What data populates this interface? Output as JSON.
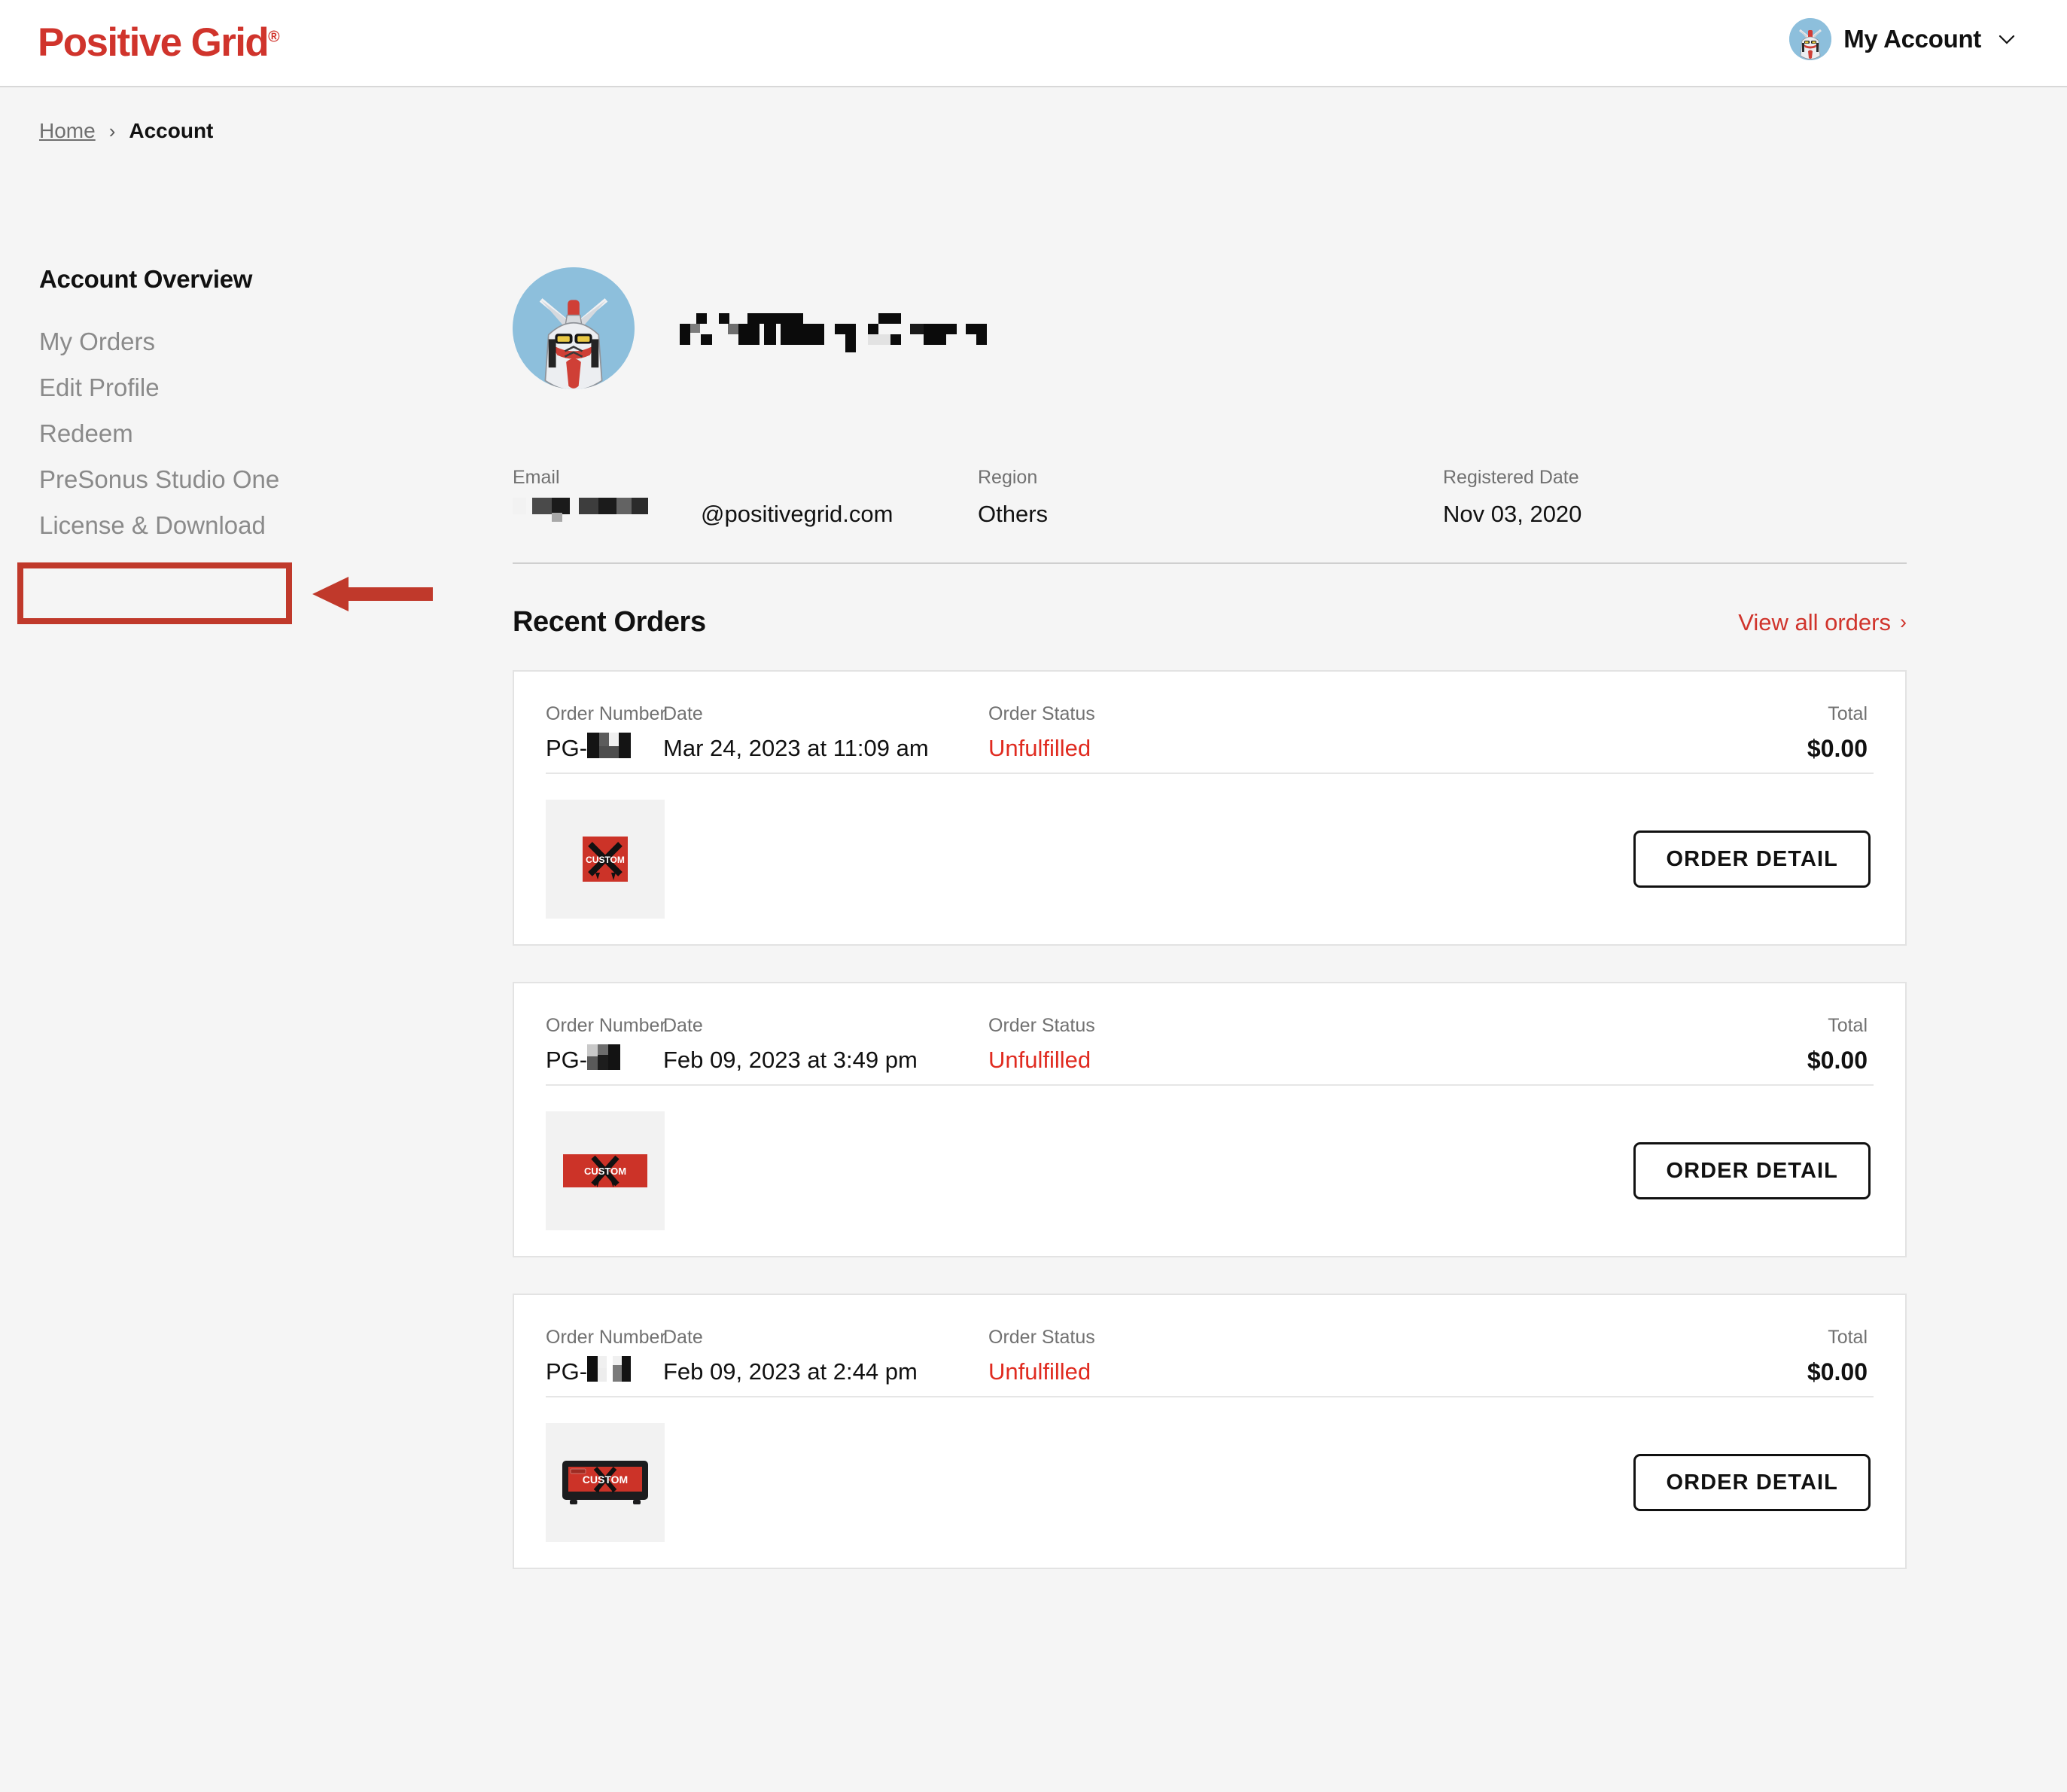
{
  "brand": {
    "name": "Positive Grid",
    "registered_mark": "®",
    "color": "#d0342c"
  },
  "header": {
    "account_label": "My Account",
    "avatar_alt": "gundam-avatar",
    "chevron": "chevron-down-icon"
  },
  "breadcrumb": {
    "home": "Home",
    "separator": "›",
    "current": "Account"
  },
  "sidebar": {
    "heading": "Account Overview",
    "items": [
      {
        "label": "My Orders",
        "active": false
      },
      {
        "label": "Edit Profile",
        "active": false
      },
      {
        "label": "Redeem",
        "active": false
      },
      {
        "label": "PreSonus Studio One",
        "active": false
      },
      {
        "label": "License & Download",
        "active": false,
        "annotated": true
      }
    ]
  },
  "annotation": {
    "color": "#c0392b",
    "target": "License & Download",
    "shape": "rectangle-with-left-arrow"
  },
  "profile": {
    "display_name": "[redacted]",
    "fields": [
      {
        "label": "Email",
        "value": "███ ████@positivegrid.com"
      },
      {
        "label": "Region",
        "value": "Others"
      },
      {
        "label": "Registered Date",
        "value": "Nov 03, 2020"
      }
    ]
  },
  "orders_section": {
    "title": "Recent Orders",
    "view_all_label": "View all orders",
    "view_all_chevron": "›",
    "column_labels": {
      "number": "Order Number",
      "date": "Date",
      "status": "Order Status",
      "total": "Total"
    },
    "detail_button_label": "ORDER DETAIL",
    "status_color": "#e02b20",
    "orders": [
      {
        "number_prefix": "PG-",
        "number_value": "[redacted]",
        "date": "Mar 24, 2023 at 11:09 am",
        "status": "Unfulfilled",
        "total": "$0.00",
        "thumbnail": "custom-square-badge"
      },
      {
        "number_prefix": "PG-",
        "number_value": "[redacted]",
        "date": "Feb 09, 2023 at 3:49 pm",
        "status": "Unfulfilled",
        "total": "$0.00",
        "thumbnail": "custom-wide-banner"
      },
      {
        "number_prefix": "PG-",
        "number_value": "[redacted]",
        "date": "Feb 09, 2023 at 2:44 pm",
        "status": "Unfulfilled",
        "total": "$0.00",
        "thumbnail": "custom-amp-head"
      }
    ]
  }
}
